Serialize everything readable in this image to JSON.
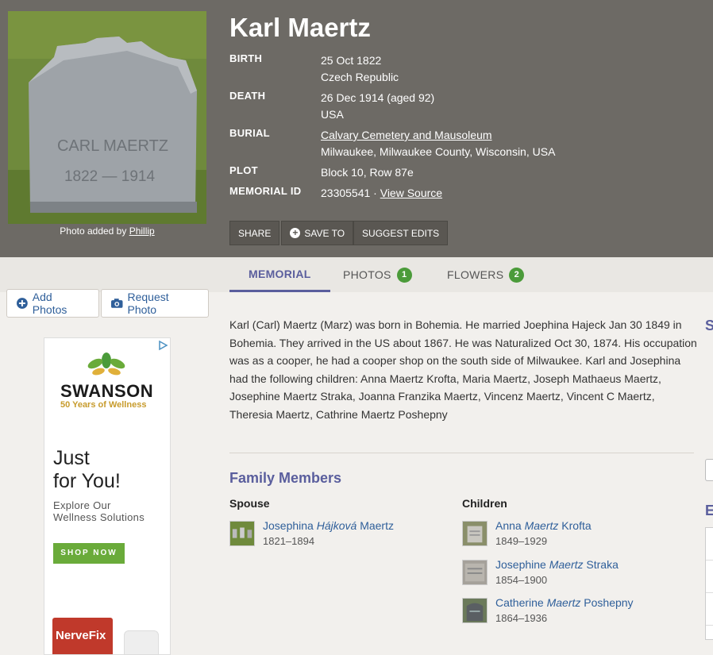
{
  "memorial": {
    "name": "Karl Maertz",
    "photo_caption_prefix": "Photo added by ",
    "photo_caption_user": "Phillip",
    "photo_inscription_name": "CARL MAERTZ",
    "photo_inscription_years": "1822 — 1914",
    "birth": {
      "label": "BIRTH",
      "date": "25 Oct 1822",
      "place": "Czech Republic"
    },
    "death": {
      "label": "DEATH",
      "date": "26 Dec 1914 (aged 92)",
      "place": "USA"
    },
    "burial": {
      "label": "BURIAL",
      "cemetery": "Calvary Cemetery and Mausoleum",
      "place": "Milwaukee, Milwaukee County, Wisconsin, USA"
    },
    "plot": {
      "label": "PLOT",
      "value": "Block 10, Row 87e"
    },
    "memorial_id": {
      "label": "MEMORIAL ID",
      "value": "23305541 · ",
      "source_link": "View Source"
    }
  },
  "actions": {
    "share": "SHARE",
    "save_to": "SAVE TO",
    "suggest_edits": "SUGGEST EDITS"
  },
  "tabs": [
    {
      "label": "MEMORIAL"
    },
    {
      "label": "PHOTOS",
      "count": "1"
    },
    {
      "label": "FLOWERS",
      "count": "2"
    }
  ],
  "sidebar": {
    "add_photos": "Add Photos",
    "request_photo": "Request Photo"
  },
  "ad": {
    "brand": "SWANSON",
    "years": "50 Years of Wellness",
    "headline_1": "Just",
    "headline_2": "for You!",
    "sub_1": "Explore Our",
    "sub_2": "Wellness Solutions",
    "cta": "SHOP NOW",
    "product": "NerveFix"
  },
  "bio": "Karl (Carl) Maertz (Marz) was born in Bohemia. He married Joephina Hajeck Jan 30 1849 in Bohemia. They arrived in the US about 1867. He was Naturalized Oct 30, 1874. His occupation was as a cooper, he had a cooper shop on the south side of Milwaukee. Karl and Josephina had the following children: Anna Maertz Krofta, Maria Maertz, Joseph Mathaeus Maertz, Josephine Maertz Straka, Joanna Franzika Maertz, Vincenz Maertz, Vincent C Maertz, Theresia Maertz, Cathrine Maertz Poshepny",
  "family": {
    "title": "Family Members",
    "spouse_heading": "Spouse",
    "children_heading": "Children",
    "spouse": [
      {
        "first": "Josephina ",
        "maiden": "Hájková",
        "last": " Maertz",
        "dates": "1821–1894"
      }
    ],
    "children": [
      {
        "first": "Anna ",
        "maiden": "Maertz",
        "last": " Krofta",
        "dates": "1849–1929"
      },
      {
        "first": "Josephine ",
        "maiden": "Maertz",
        "last": " Straka",
        "dates": "1854–1900"
      },
      {
        "first": "Catherine ",
        "maiden": "Maertz",
        "last": " Poshepny",
        "dates": "1864–1936"
      }
    ]
  },
  "right_column": {
    "peek_1": "S",
    "peek_2": "E"
  },
  "colors": {
    "header_bg": "#6d6a65",
    "accent": "#5a5e9d",
    "link": "#2f5f9a",
    "badge": "#4b9b3a"
  }
}
